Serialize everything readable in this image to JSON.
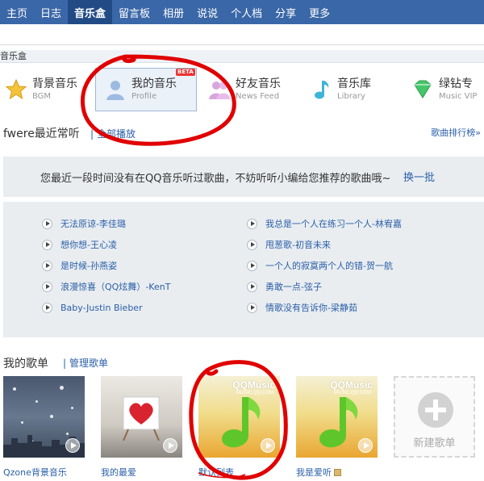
{
  "topnav": {
    "items": [
      "主页",
      "日志",
      "音乐盒",
      "留言板",
      "相册",
      "说说",
      "个人档",
      "分享",
      "更多"
    ],
    "active_index": 2
  },
  "section_label": "音乐盒",
  "tabs": [
    {
      "title": "背景音乐",
      "subtitle": "BGM",
      "icon": "star-icon"
    },
    {
      "title": "我的音乐",
      "subtitle": "Profile",
      "icon": "user-icon",
      "badge": "BETA"
    },
    {
      "title": "好友音乐",
      "subtitle": "News Feed",
      "icon": "friends-icon"
    },
    {
      "title": "音乐库",
      "subtitle": "Library",
      "icon": "music-note-icon"
    },
    {
      "title": "绿钻专",
      "subtitle": "Music VIP",
      "icon": "green-diamond-icon"
    }
  ],
  "recent": {
    "title": "fwere最近常听",
    "play_all": "全部播放",
    "ranking": "歌曲排行榜»"
  },
  "notice": {
    "message": "您最近一段时间没有在QQ音乐听过歌曲，不妨听听小编给您推荐的歌曲哦~",
    "refresh": "换一批"
  },
  "songs_left": [
    "无法原谅-李佳璐",
    "想你想-王心凌",
    "是时候-孙燕姿",
    "浪漫惊喜（QQ炫舞）-KenT",
    "Baby-Justin Bieber"
  ],
  "songs_right": [
    "我总是一个人在练习一个人-林宥嘉",
    "甩葱歌-初音未来",
    "一个人的寂寞两个人的错-贺一航",
    "勇敢一点-弦子",
    "情歌没有告诉你-梁静茹"
  ],
  "mylists": {
    "title": "我的歌单",
    "manage": "管理歌单",
    "items": [
      {
        "caption": "Qzone背景音乐"
      },
      {
        "caption": "我的最爱"
      },
      {
        "caption": "默认列表"
      },
      {
        "caption": "我是爱听"
      }
    ],
    "cover_brand": "QQMusic",
    "cover_brand_sub": "MUSIC.QQ.COM",
    "new_list": "新建歌单"
  },
  "colors": {
    "nav_bg": "#3a67a7",
    "nav_active": "#224b86",
    "link": "#2b5fa8",
    "panel_bg": "#e9edf0",
    "annotation": "#e00000"
  }
}
